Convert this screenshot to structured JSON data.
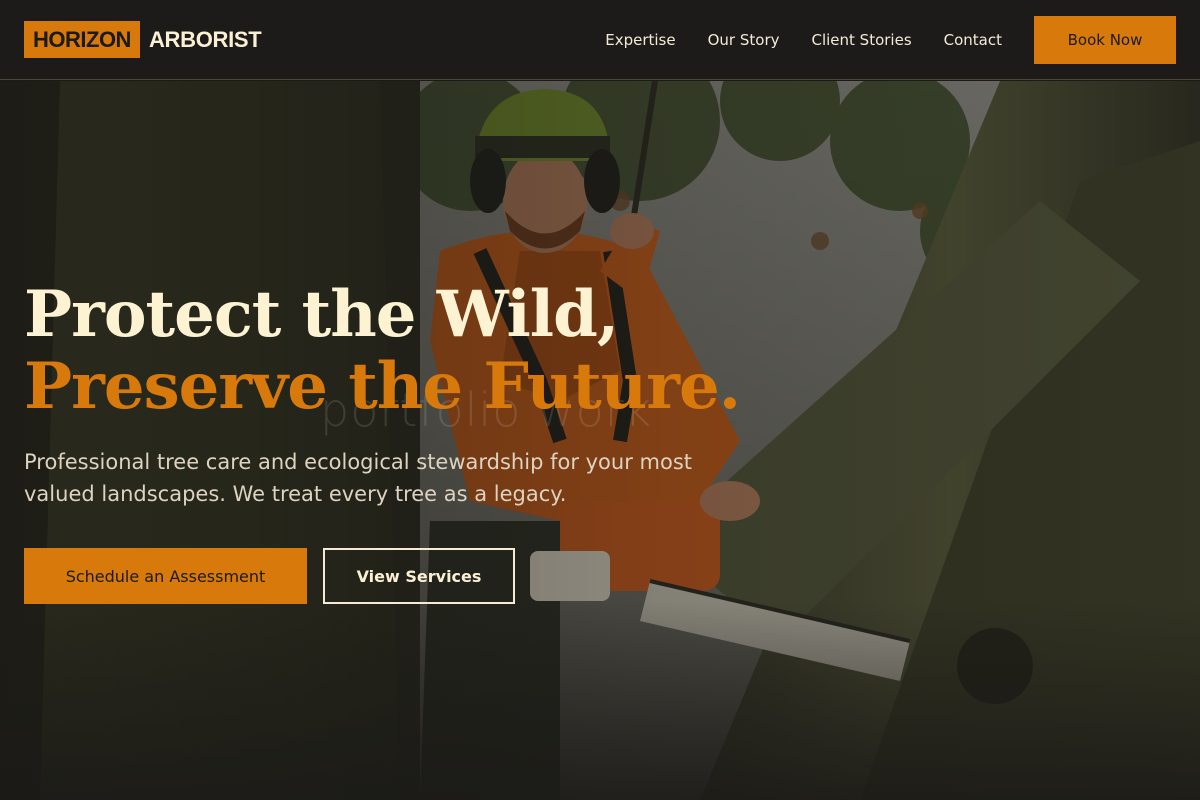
{
  "header": {
    "logo_box": "HORIZON",
    "logo_text": "ARBORIST",
    "nav": [
      {
        "label": "Expertise"
      },
      {
        "label": "Our Story"
      },
      {
        "label": "Client Stories"
      },
      {
        "label": "Contact"
      }
    ],
    "cta": "Book Now"
  },
  "hero": {
    "headline_line1": "Protect the Wild,",
    "headline_line2": "Preserve the Future.",
    "subtitle": "Professional tree care and ecological stewardship for your most valued landscapes. We treat every tree as a legacy.",
    "primary_button": "Schedule an Assessment",
    "secondary_button": "View Services",
    "watermark": "portfolio work"
  },
  "colors": {
    "accent": "#d8790c",
    "background": "#1b1a17",
    "cream": "#fdf3d3"
  }
}
